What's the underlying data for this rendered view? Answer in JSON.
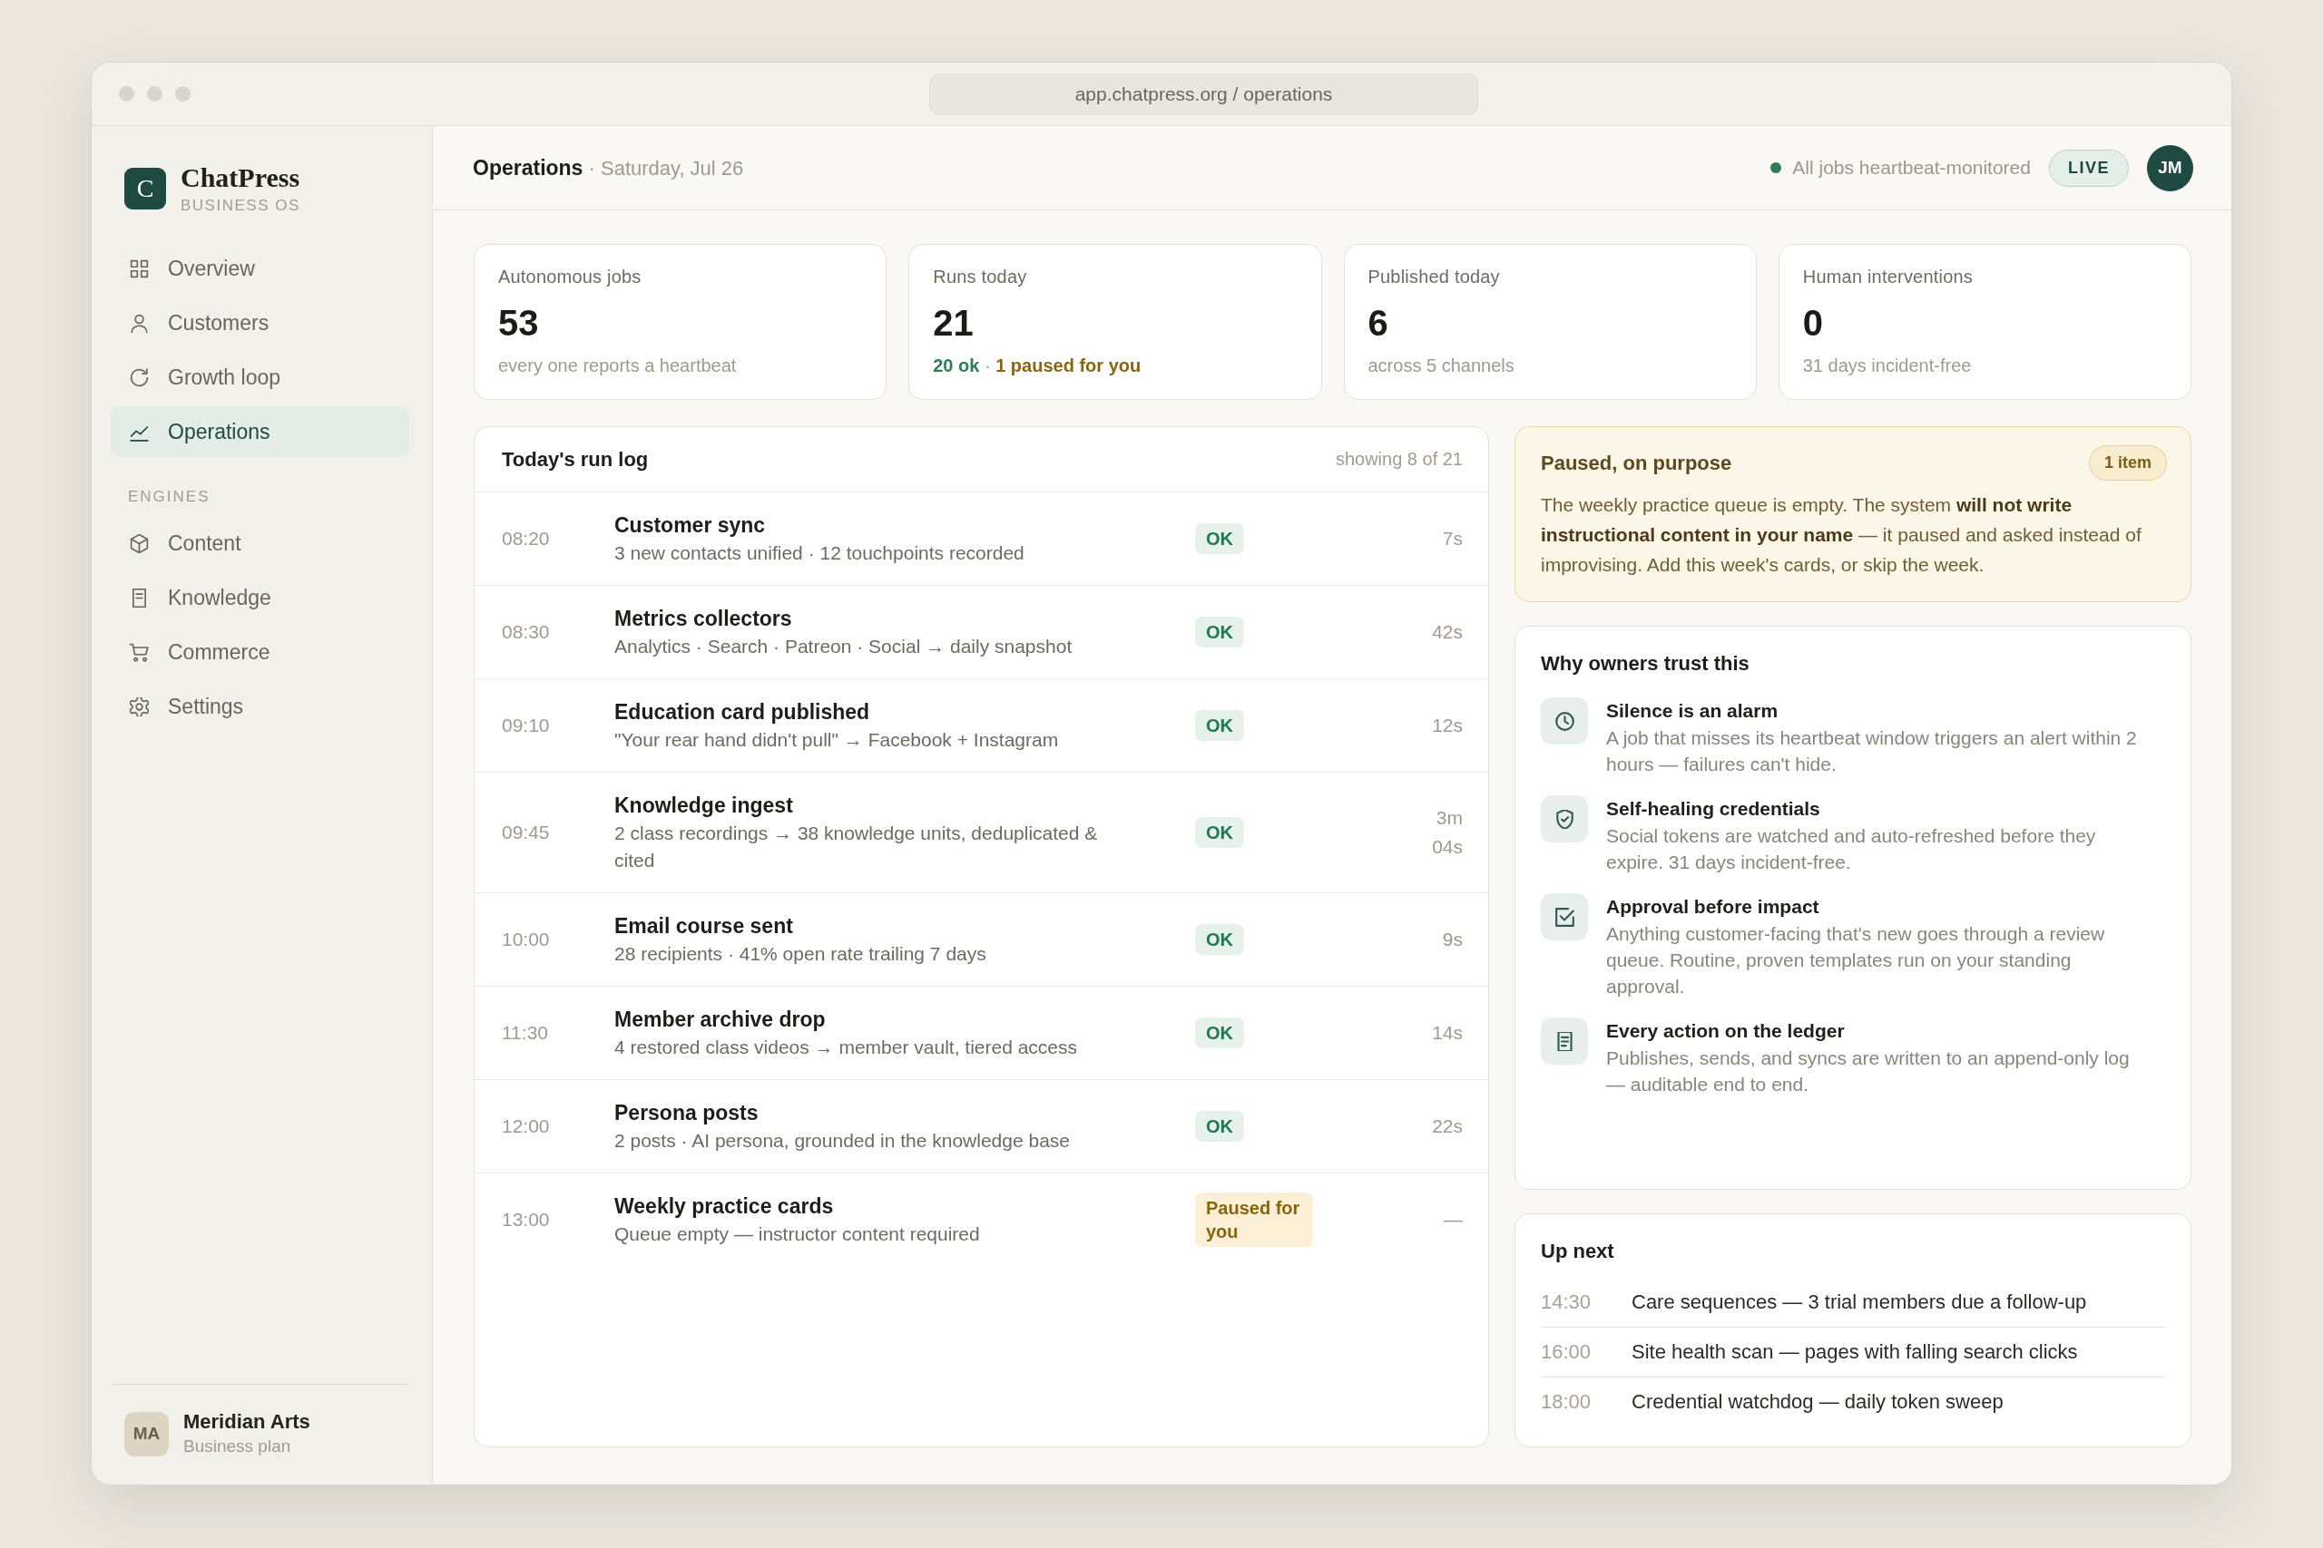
{
  "window": {
    "url": "app.chatpress.org / operations"
  },
  "sidebar": {
    "brand": {
      "mark": "C",
      "name": "ChatPress",
      "tagline": "BUSINESS OS"
    },
    "sections": [
      {
        "items": [
          {
            "label": "Overview",
            "selected": false
          },
          {
            "label": "Customers",
            "selected": false
          },
          {
            "label": "Growth loop",
            "selected": false
          },
          {
            "label": "Operations",
            "selected": true
          }
        ]
      },
      {
        "heading": "ENGINES",
        "items": [
          {
            "label": "Content",
            "selected": false
          },
          {
            "label": "Knowledge",
            "selected": false
          },
          {
            "label": "Commerce",
            "selected": false
          },
          {
            "label": "Settings",
            "selected": false
          }
        ]
      }
    ],
    "account": {
      "initials": "MA",
      "name": "Meridian Arts",
      "plan": "Business plan"
    }
  },
  "header": {
    "heading": "**Operations** · Saturday, Jul 26",
    "status": "All jobs heartbeat-monitored",
    "badge": "LIVE",
    "avatar": "JM"
  },
  "stats": [
    {
      "label": "Autonomous jobs",
      "value": "53",
      "note": [
        {
          "text": "every one reports a heartbeat",
          "kind": "muted"
        }
      ]
    },
    {
      "label": "Runs today",
      "value": "21",
      "note": [
        {
          "text": "20 ok",
          "kind": "ok"
        },
        {
          "text": " · ",
          "kind": "muted"
        },
        {
          "text": "1 paused for you",
          "kind": "paused"
        }
      ]
    },
    {
      "label": "Published today",
      "value": "6",
      "note": [
        {
          "text": "across 5 channels",
          "kind": "muted"
        }
      ]
    },
    {
      "label": "Human interventions",
      "value": "0",
      "note": [
        {
          "text": "31 days incident-free",
          "kind": "muted"
        }
      ]
    }
  ],
  "run_log": {
    "title": "Today's run log",
    "count": "showing 8 of 21",
    "rows": [
      {
        "time": "08:20",
        "title": "Customer sync",
        "detail": "3 new contacts unified · 12 touchpoints recorded",
        "status": {
          "kind": "ok",
          "label": "OK"
        },
        "duration": "7s"
      },
      {
        "time": "08:30",
        "title": "Metrics collectors",
        "detail": "Analytics · Search · Patreon · Social → daily snapshot",
        "status": {
          "kind": "ok",
          "label": "OK"
        },
        "duration": "42s"
      },
      {
        "time": "09:10",
        "title": "Education card published",
        "detail": "\"Your rear hand didn't pull\" → Facebook + Instagram",
        "status": {
          "kind": "ok",
          "label": "OK"
        },
        "duration": "12s"
      },
      {
        "time": "09:45",
        "title": "Knowledge ingest",
        "detail": "2 class recordings → 38 knowledge units, deduplicated & cited",
        "status": {
          "kind": "ok",
          "label": "OK"
        },
        "duration": "3m 04s"
      },
      {
        "time": "10:00",
        "title": "Email course sent",
        "detail": "28 recipients · 41% open rate trailing 7 days",
        "status": {
          "kind": "ok",
          "label": "OK"
        },
        "duration": "9s"
      },
      {
        "time": "11:30",
        "title": "Member archive drop",
        "detail": "4 restored class videos → member vault, tiered access",
        "status": {
          "kind": "ok",
          "label": "OK"
        },
        "duration": "14s"
      },
      {
        "time": "12:00",
        "title": "Persona posts",
        "detail": "2 posts · AI persona, grounded in the knowledge base",
        "status": {
          "kind": "ok",
          "label": "OK"
        },
        "duration": "22s"
      },
      {
        "time": "13:00",
        "title": "Weekly practice cards",
        "detail": "Queue empty — instructor content required",
        "status": {
          "kind": "paused",
          "label": "Paused for you"
        },
        "duration": "—"
      }
    ]
  },
  "paused_notice": {
    "title": "Paused, on purpose",
    "badge": "1 item",
    "body": "The weekly practice queue is empty. The system **will not write instructional content in your name** — it paused and asked instead of improvising. Add this week's cards, or skip the week."
  },
  "trust": {
    "title": "Why owners trust this",
    "items": [
      {
        "title": "Silence is an alarm",
        "text": "A job that misses its heartbeat window triggers an alert within 2 hours — failures can't hide."
      },
      {
        "title": "Self-healing credentials",
        "text": "Social tokens are watched and auto-refreshed before they expire. 31 days incident-free."
      },
      {
        "title": "Approval before impact",
        "text": "Anything customer-facing that's new goes through a review queue. Routine, proven templates run on your standing approval."
      },
      {
        "title": "Every action on the ledger",
        "text": "Publishes, sends, and syncs are written to an append-only log — auditable end to end."
      }
    ]
  },
  "up_next": {
    "title": "Up next",
    "items": [
      {
        "time": "14:30",
        "text": "Care sequences — 3 trial members due a follow-up"
      },
      {
        "time": "16:00",
        "text": "Site health scan — pages with falling search clicks"
      },
      {
        "time": "18:00",
        "text": "Credential watchdog — daily token sweep"
      }
    ]
  }
}
